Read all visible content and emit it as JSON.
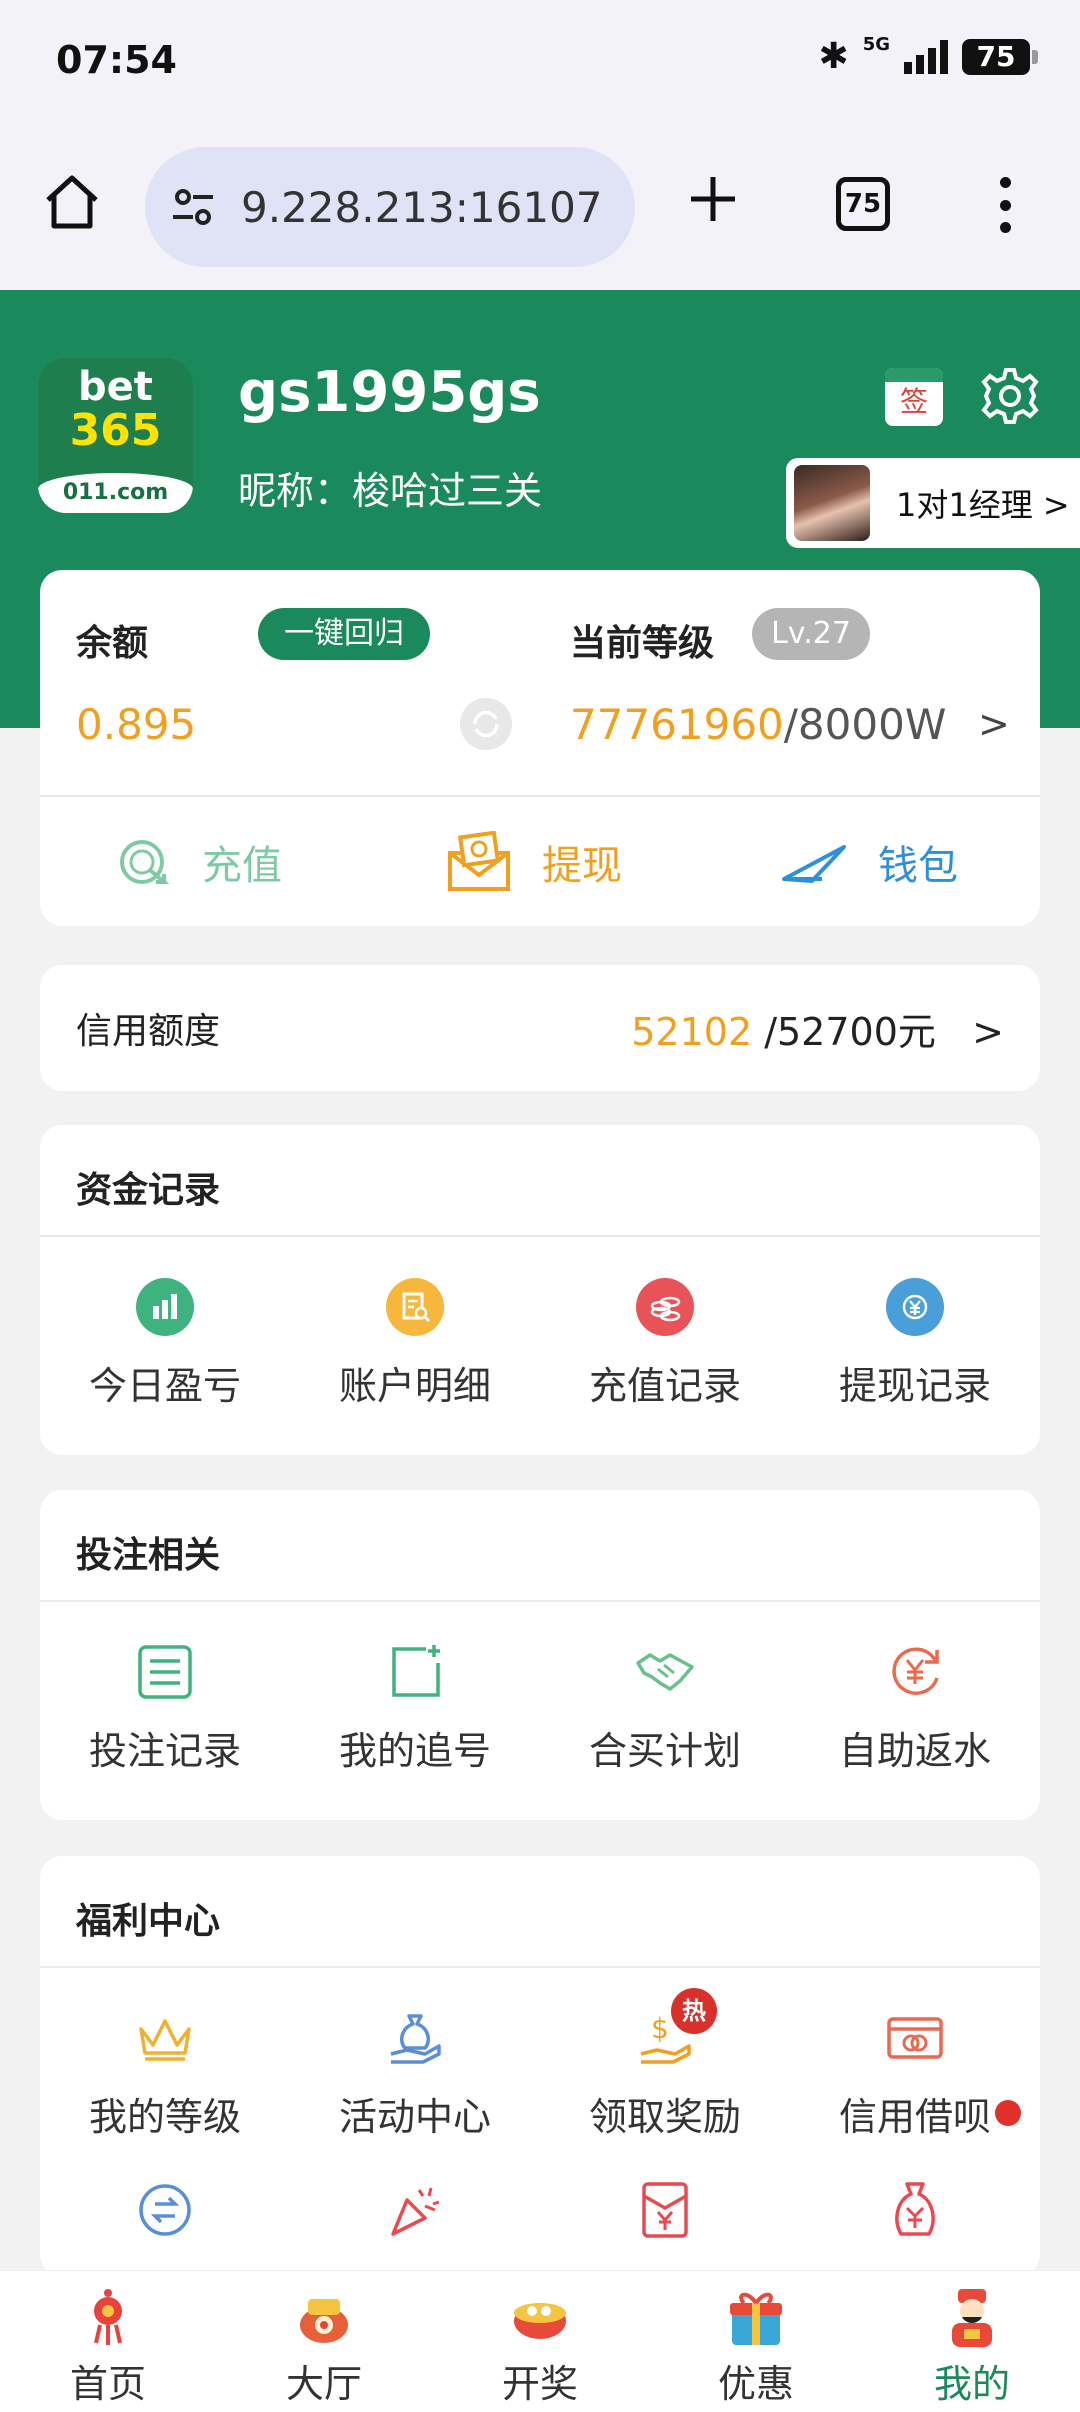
{
  "status_bar": {
    "time": "07:54",
    "network": "5G",
    "battery": "75"
  },
  "browser": {
    "url": "9.228.213:16107",
    "tab_count": "75"
  },
  "profile": {
    "logo_line1": "bet",
    "logo_line2": "365",
    "logo_line3": "011.com",
    "username": "gs1995gs",
    "nickname": "昵称：梭哈过三关",
    "sign_label": "签",
    "manager_label": "1对1经理 >"
  },
  "balance": {
    "label": "余额",
    "one_key_return": "一键回归",
    "value": "0.895",
    "level_label": "当前等级",
    "level_badge": "Lv.27",
    "level_progress": "77761960",
    "level_max": "/8000W",
    "arrow": ">",
    "actions": [
      {
        "label": "充值",
        "icon": "recharge-icon"
      },
      {
        "label": "提现",
        "icon": "withdraw-icon"
      },
      {
        "label": "钱包",
        "icon": "wallet-icon"
      }
    ]
  },
  "credit": {
    "label": "信用额度",
    "used": "52102",
    "total": " /52700元",
    "arrow": ">"
  },
  "fund_records": {
    "title": "资金记录",
    "items": [
      {
        "label": "今日盈亏",
        "icon": "bar-chart-icon",
        "color": "#3fb37f"
      },
      {
        "label": "账户明细",
        "icon": "document-search-icon",
        "color": "#f6b73c"
      },
      {
        "label": "充值记录",
        "icon": "coins-icon",
        "color": "#e8535a"
      },
      {
        "label": "提现记录",
        "icon": "yuan-exchange-icon",
        "color": "#4a9fd8"
      }
    ]
  },
  "bet_related": {
    "title": "投注相关",
    "items": [
      {
        "label": "投注记录",
        "icon": "list-icon"
      },
      {
        "label": "我的追号",
        "icon": "add-square-icon"
      },
      {
        "label": "合买计划",
        "icon": "handshake-icon"
      },
      {
        "label": "自助返水",
        "icon": "yuan-refresh-icon"
      }
    ]
  },
  "welfare": {
    "title": "福利中心",
    "items": [
      {
        "label": "我的等级",
        "icon": "crown-icon"
      },
      {
        "label": "活动中心",
        "icon": "money-bag-hand-icon"
      },
      {
        "label": "领取奖励",
        "icon": "reward-hand-icon",
        "badge": "热"
      },
      {
        "label": "信用借呗",
        "icon": "credit-card-icon"
      }
    ],
    "row2_icons": [
      "transfer-icon",
      "party-popper-icon",
      "red-envelope-icon",
      "money-bag-icon"
    ]
  },
  "bottom_nav": [
    {
      "label": "首页",
      "icon": "home-knot-icon"
    },
    {
      "label": "大厅",
      "icon": "lobby-icon"
    },
    {
      "label": "开奖",
      "icon": "lottery-drum-icon"
    },
    {
      "label": "优惠",
      "icon": "gift-box-icon"
    },
    {
      "label": "我的",
      "icon": "fortune-god-icon",
      "active": true
    }
  ],
  "colors": {
    "brand_green": "#1a8a5c",
    "accent_orange": "#f0a020",
    "link_blue": "#2f8fd8"
  }
}
